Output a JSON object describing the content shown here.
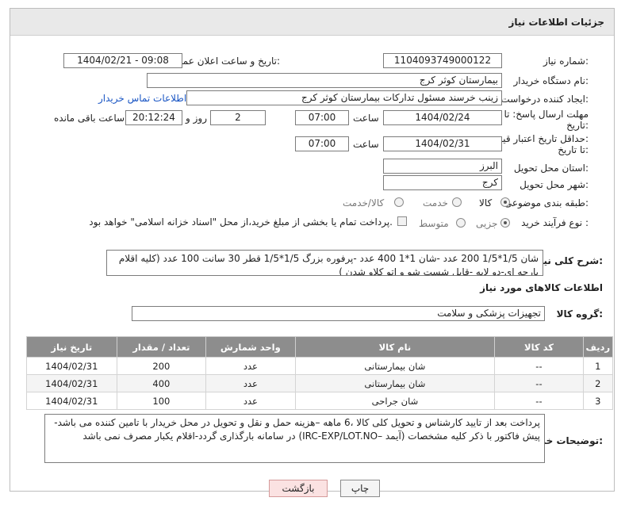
{
  "header": {
    "title": "جزئیات اطلاعات نیاز"
  },
  "need_number": {
    "label": "شماره نیاز:",
    "value": "1104093749000122"
  },
  "announce": {
    "label": "تاریخ و ساعت اعلان عمومی:",
    "value": "1404/02/21 - 09:08"
  },
  "buyer_org": {
    "label": "نام دستگاه خریدار:",
    "value": "بیمارستان کوثر کرج"
  },
  "requester": {
    "label": "ایجاد کننده درخواست:",
    "value": "زینب خرسند مسئول تداركات بيمارستان كوثر كرج",
    "contact_link": "اطلاعات تماس خریدار"
  },
  "send_deadline": {
    "label1": "مهلت ارسال پاسخ: تا",
    "label2": "تاریخ:",
    "date": "1404/02/24",
    "time_label": "ساعت",
    "time": "07:00",
    "days": "2",
    "days_label": "روز و",
    "remaining": "20:12:24",
    "remaining_label": "ساعت باقی مانده"
  },
  "price_validity": {
    "label1": "حداقل تاریخ اعتبار قیمت:",
    "label2": "تا تاریخ:",
    "date": "1404/02/31",
    "time_label": "ساعت",
    "time": "07:00"
  },
  "province": {
    "label": "استان محل تحویل:",
    "value": "البرز"
  },
  "city": {
    "label": "شهر محل تحویل:",
    "value": "کرج"
  },
  "category": {
    "label": "طبقه بندی موضوعی:",
    "options": [
      "کالا",
      "خدمت",
      "کالا/خدمت"
    ],
    "selected": "کالا"
  },
  "purchase_type": {
    "label": "نوع فرآیند خرید :",
    "options": [
      "جزیی",
      "متوسط"
    ],
    "selected": "جزیی",
    "note": "پرداخت تمام یا بخشی از مبلغ خرید،از محل \"اسناد خزانه اسلامی\" خواهد بود."
  },
  "description": {
    "label": "شرح کلی نیاز:",
    "text": "شان 1/5*1/5   200 عدد -شان 1*1   400 عدد -پرفوره بزرگ 1/5*1/5 قطر 30 سانت  100 عدد (کلیه اقلام پارچه ای-دو لایه -قابل شست شو و اتو کلاو  شدن )"
  },
  "goods_info": {
    "title": "اطلاعات کالاهای مورد نیاز"
  },
  "goods_group": {
    "label": "گروه کالا:",
    "value": "تجهیزات پزشکی و سلامت"
  },
  "table": {
    "headers": [
      "ردیف",
      "کد کالا",
      "نام کالا",
      "واحد شمارش",
      "تعداد / مقدار",
      "تاریخ نیاز"
    ],
    "rows": [
      [
        "1",
        "--",
        "شان بیمارستانی",
        "عدد",
        "200",
        "1404/02/31"
      ],
      [
        "2",
        "--",
        "شان بیمارستانی",
        "عدد",
        "400",
        "1404/02/31"
      ],
      [
        "3",
        "--",
        "شان جراحی",
        "عدد",
        "100",
        "1404/02/31"
      ]
    ]
  },
  "buyer_notes": {
    "label": "توضیحات خریدار:",
    "text": "پرداخت بعد از تایید کارشناس و تحویل کلی کالا ،6 ماهه –هزینه حمل و نقل و تحویل در محل خریدار با تامین کننده می باشد-پیش فاکتور با ذکر کلیه مشخصات (آیمد –IRC-EXP/LOT.NO) در سامانه بارگذاری گردد-اقلام یکبار مصرف نمی باشد"
  },
  "buttons": {
    "print": "چاپ",
    "back": "بازگشت"
  },
  "colors": {
    "link": "#1a56c4",
    "table_header": "#8d8d8d",
    "back_button": "#fbe2e2"
  }
}
